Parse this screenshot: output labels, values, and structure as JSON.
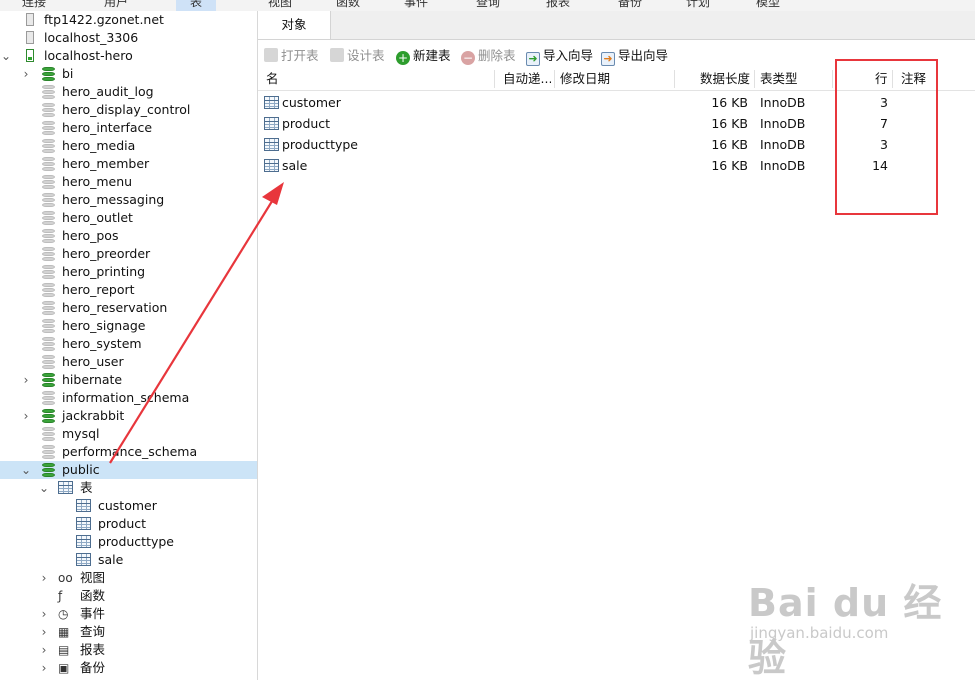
{
  "topmenu": {
    "items": [
      "连接",
      "用户",
      "表",
      "视图",
      "函数",
      "事件",
      "查询",
      "报表",
      "备份",
      "计划",
      "模型"
    ],
    "active_index": 2
  },
  "navigator": {
    "items": [
      {
        "label": "ftp1422.gzonet.net",
        "icon": "server-icon",
        "state": "off",
        "depth": 0,
        "arrow": ""
      },
      {
        "label": "localhost_3306",
        "icon": "server-icon",
        "state": "off",
        "depth": 0,
        "arrow": ""
      },
      {
        "label": "localhost-hero",
        "icon": "server-icon",
        "state": "on",
        "depth": 0,
        "arrow": "down"
      },
      {
        "label": "bi",
        "icon": "database-icon",
        "state": "open",
        "depth": 1,
        "arrow": "right"
      },
      {
        "label": "hero_audit_log",
        "icon": "database-icon",
        "state": "closed",
        "depth": 1,
        "arrow": ""
      },
      {
        "label": "hero_display_control",
        "icon": "database-icon",
        "state": "closed",
        "depth": 1,
        "arrow": ""
      },
      {
        "label": "hero_interface",
        "icon": "database-icon",
        "state": "closed",
        "depth": 1,
        "arrow": ""
      },
      {
        "label": "hero_media",
        "icon": "database-icon",
        "state": "closed",
        "depth": 1,
        "arrow": ""
      },
      {
        "label": "hero_member",
        "icon": "database-icon",
        "state": "closed",
        "depth": 1,
        "arrow": ""
      },
      {
        "label": "hero_menu",
        "icon": "database-icon",
        "state": "closed",
        "depth": 1,
        "arrow": ""
      },
      {
        "label": "hero_messaging",
        "icon": "database-icon",
        "state": "closed",
        "depth": 1,
        "arrow": ""
      },
      {
        "label": "hero_outlet",
        "icon": "database-icon",
        "state": "closed",
        "depth": 1,
        "arrow": ""
      },
      {
        "label": "hero_pos",
        "icon": "database-icon",
        "state": "closed",
        "depth": 1,
        "arrow": ""
      },
      {
        "label": "hero_preorder",
        "icon": "database-icon",
        "state": "closed",
        "depth": 1,
        "arrow": ""
      },
      {
        "label": "hero_printing",
        "icon": "database-icon",
        "state": "closed",
        "depth": 1,
        "arrow": ""
      },
      {
        "label": "hero_report",
        "icon": "database-icon",
        "state": "closed",
        "depth": 1,
        "arrow": ""
      },
      {
        "label": "hero_reservation",
        "icon": "database-icon",
        "state": "closed",
        "depth": 1,
        "arrow": ""
      },
      {
        "label": "hero_signage",
        "icon": "database-icon",
        "state": "closed",
        "depth": 1,
        "arrow": ""
      },
      {
        "label": "hero_system",
        "icon": "database-icon",
        "state": "closed",
        "depth": 1,
        "arrow": ""
      },
      {
        "label": "hero_user",
        "icon": "database-icon",
        "state": "closed",
        "depth": 1,
        "arrow": ""
      },
      {
        "label": "hibernate",
        "icon": "database-icon",
        "state": "open",
        "depth": 1,
        "arrow": "right"
      },
      {
        "label": "information_schema",
        "icon": "database-icon",
        "state": "closed",
        "depth": 1,
        "arrow": ""
      },
      {
        "label": "jackrabbit",
        "icon": "database-icon",
        "state": "open",
        "depth": 1,
        "arrow": "right"
      },
      {
        "label": "mysql",
        "icon": "database-icon",
        "state": "closed",
        "depth": 1,
        "arrow": ""
      },
      {
        "label": "performance_schema",
        "icon": "database-icon",
        "state": "closed",
        "depth": 1,
        "arrow": ""
      },
      {
        "label": "public",
        "icon": "database-icon",
        "state": "open",
        "depth": 1,
        "arrow": "down",
        "selected": true
      },
      {
        "label": "表",
        "icon": "table-icon",
        "state": "",
        "depth": 2,
        "arrow": "down"
      },
      {
        "label": "customer",
        "icon": "table-icon",
        "state": "",
        "depth": 3,
        "arrow": ""
      },
      {
        "label": "product",
        "icon": "table-icon",
        "state": "",
        "depth": 3,
        "arrow": ""
      },
      {
        "label": "producttype",
        "icon": "table-icon",
        "state": "",
        "depth": 3,
        "arrow": ""
      },
      {
        "label": "sale",
        "icon": "table-icon",
        "state": "",
        "depth": 3,
        "arrow": ""
      },
      {
        "label": "视图",
        "icon": "view-icon",
        "state": "",
        "depth": 2,
        "arrow": "right"
      },
      {
        "label": "函数",
        "icon": "function-icon",
        "state": "",
        "depth": 2,
        "arrow": ""
      },
      {
        "label": "事件",
        "icon": "event-icon",
        "state": "",
        "depth": 2,
        "arrow": "right"
      },
      {
        "label": "查询",
        "icon": "query-icon",
        "state": "",
        "depth": 2,
        "arrow": "right"
      },
      {
        "label": "报表",
        "icon": "report-icon",
        "state": "",
        "depth": 2,
        "arrow": "right"
      },
      {
        "label": "备份",
        "icon": "backup-icon",
        "state": "",
        "depth": 2,
        "arrow": "right"
      }
    ]
  },
  "tabs": {
    "object_tab": "对象"
  },
  "toolbar": {
    "open_table": "打开表",
    "design_table": "设计表",
    "new_table": "新建表",
    "delete_table": "删除表",
    "import_wizard": "导入向导",
    "export_wizard": "导出向导"
  },
  "table_header": {
    "name": "名",
    "auto_increment": "自动递...",
    "modified_date": "修改日期",
    "data_length": "数据长度",
    "engine": "表类型",
    "rows": "行",
    "comment": "注释"
  },
  "tables": [
    {
      "name": "customer",
      "data_length": "16 KB",
      "engine": "InnoDB",
      "rows": "3"
    },
    {
      "name": "product",
      "data_length": "16 KB",
      "engine": "InnoDB",
      "rows": "7"
    },
    {
      "name": "producttype",
      "data_length": "16 KB",
      "engine": "InnoDB",
      "rows": "3"
    },
    {
      "name": "sale",
      "data_length": "16 KB",
      "engine": "InnoDB",
      "rows": "14"
    }
  ],
  "colors": {
    "selection": "#cce4f7",
    "annotation": "#e8363c",
    "db_active": "#3aa43a"
  },
  "watermark": {
    "logo": "Bai du 经验",
    "url": "jingyan.baidu.com"
  }
}
